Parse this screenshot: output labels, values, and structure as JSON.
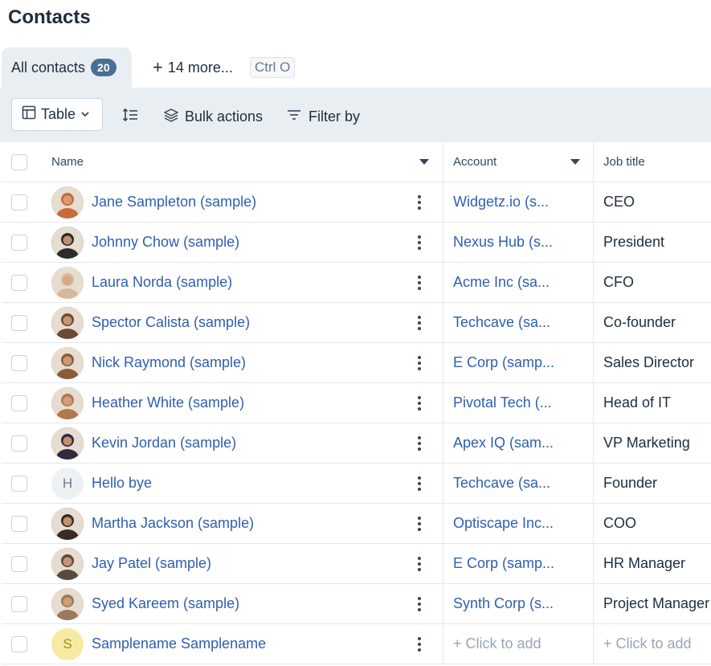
{
  "page": {
    "title": "Contacts"
  },
  "tabs": {
    "active_label": "All contacts",
    "active_count": "20",
    "more_label": "14 more...",
    "shortcut": "Ctrl O"
  },
  "toolbar": {
    "view_label": "Table",
    "bulk_actions_label": "Bulk actions",
    "filter_label": "Filter by"
  },
  "table": {
    "columns": [
      "Name",
      "Account",
      "Job title"
    ],
    "rows": [
      {
        "name": "Jane Sampleton (sample)",
        "account": "Widgetz.io (s...",
        "job": "CEO",
        "avatar_icon": "person-photo-icon",
        "avatar_color": "#c86a3c"
      },
      {
        "name": "Johnny Chow (sample)",
        "account": "Nexus Hub (s...",
        "job": "President",
        "avatar_icon": "person-photo-icon",
        "avatar_color": "#2b2b2b"
      },
      {
        "name": "Laura Norda (sample)",
        "account": "Acme Inc (sa...",
        "job": "CFO",
        "avatar_icon": "person-photo-icon",
        "avatar_color": "#d8b89a"
      },
      {
        "name": "Spector Calista (sample)",
        "account": "Techcave (sa...",
        "job": "Co-founder",
        "avatar_icon": "person-photo-icon",
        "avatar_color": "#6b4a36"
      },
      {
        "name": "Nick Raymond (sample)",
        "account": "E Corp (samp...",
        "job": "Sales Director",
        "avatar_icon": "person-photo-icon",
        "avatar_color": "#8a5a3b"
      },
      {
        "name": "Heather White (sample)",
        "account": "Pivotal Tech (...",
        "job": "Head of IT",
        "avatar_icon": "person-photo-icon",
        "avatar_color": "#b07850"
      },
      {
        "name": "Kevin Jordan (sample)",
        "account": "Apex IQ (sam...",
        "job": "VP Marketing",
        "avatar_icon": "person-photo-icon",
        "avatar_color": "#2f2a40"
      },
      {
        "name": "Hello bye",
        "account": "Techcave (sa...",
        "job": "Founder",
        "avatar_text": "H",
        "avatar_color": "#eef1f4",
        "avatar_text_color": "#6b7a8c"
      },
      {
        "name": "Martha Jackson (sample)",
        "account": "Optiscape Inc...",
        "job": "COO",
        "avatar_icon": "person-photo-icon",
        "avatar_color": "#3a2a22"
      },
      {
        "name": "Jay Patel (sample)",
        "account": "E Corp (samp...",
        "job": "HR Manager",
        "avatar_icon": "person-photo-icon",
        "avatar_color": "#5a4a3e"
      },
      {
        "name": "Syed Kareem (sample)",
        "account": "Synth Corp (s...",
        "job": "Project Manager",
        "avatar_icon": "person-photo-icon",
        "avatar_color": "#9a7a5a"
      },
      {
        "name": "Samplename Samplename",
        "account": "+ Click to add",
        "job": "+ Click to add",
        "avatar_text": "S",
        "avatar_color": "#f7eaa2",
        "avatar_text_color": "#a08b2a",
        "placeholder": true
      }
    ]
  },
  "colors": {
    "link": "#2e5fb0",
    "badge": "#4a6f96",
    "toolbar_bg": "#e9eef3",
    "border": "#e3e8ee"
  }
}
